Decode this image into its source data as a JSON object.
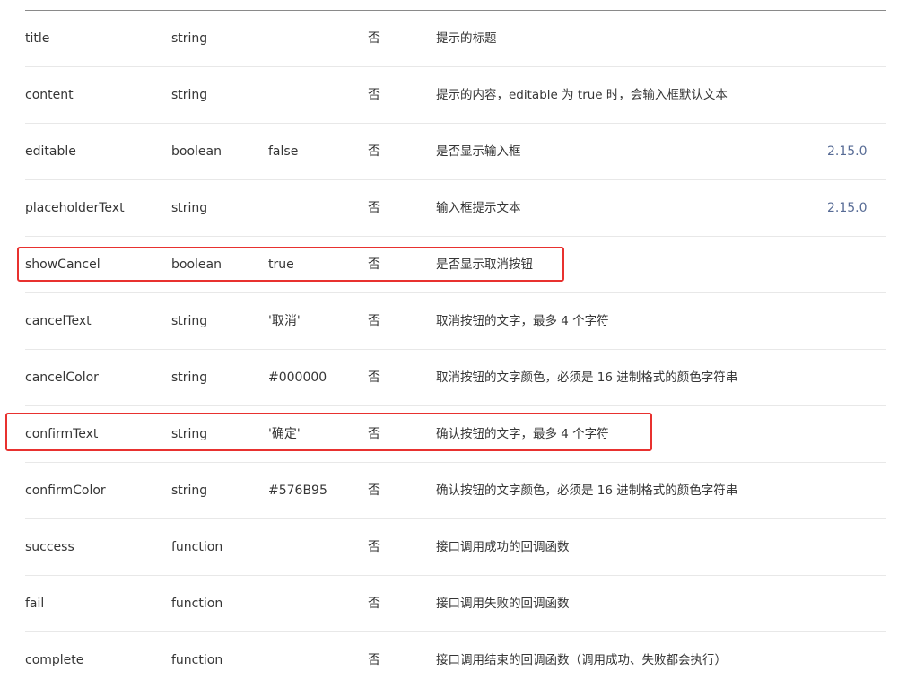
{
  "table": {
    "rows": [
      {
        "name": "title",
        "type": "string",
        "default": "",
        "required": "否",
        "desc": "提示的标题",
        "version": ""
      },
      {
        "name": "content",
        "type": "string",
        "default": "",
        "required": "否",
        "desc": "提示的内容，editable 为 true 时，会输入框默认文本",
        "version": ""
      },
      {
        "name": "editable",
        "type": "boolean",
        "default": "false",
        "required": "否",
        "desc": "是否显示输入框",
        "version": "2.15.0"
      },
      {
        "name": "placeholderText",
        "type": "string",
        "default": "",
        "required": "否",
        "desc": "输入框提示文本",
        "version": "2.15.0"
      },
      {
        "name": "showCancel",
        "type": "boolean",
        "default": "true",
        "required": "否",
        "desc": "是否显示取消按钮",
        "version": ""
      },
      {
        "name": "cancelText",
        "type": "string",
        "default": "'取消'",
        "required": "否",
        "desc": "取消按钮的文字，最多 4 个字符",
        "version": ""
      },
      {
        "name": "cancelColor",
        "type": "string",
        "default": "#000000",
        "required": "否",
        "desc": "取消按钮的文字颜色，必须是 16 进制格式的颜色字符串",
        "version": ""
      },
      {
        "name": "confirmText",
        "type": "string",
        "default": "'确定'",
        "required": "否",
        "desc": "确认按钮的文字，最多 4 个字符",
        "version": ""
      },
      {
        "name": "confirmColor",
        "type": "string",
        "default": "#576B95",
        "required": "否",
        "desc": "确认按钮的文字颜色，必须是 16 进制格式的颜色字符串",
        "version": ""
      },
      {
        "name": "success",
        "type": "function",
        "default": "",
        "required": "否",
        "desc": "接口调用成功的回调函数",
        "version": ""
      },
      {
        "name": "fail",
        "type": "function",
        "default": "",
        "required": "否",
        "desc": "接口调用失败的回调函数",
        "version": ""
      },
      {
        "name": "complete",
        "type": "function",
        "default": "",
        "required": "否",
        "desc": "接口调用结束的回调函数（调用成功、失败都会执行）",
        "version": ""
      }
    ]
  },
  "colors": {
    "highlight": "#e8312f",
    "version_link": "#576b95",
    "text": "#353535",
    "row_divider": "#e8e8e8"
  }
}
